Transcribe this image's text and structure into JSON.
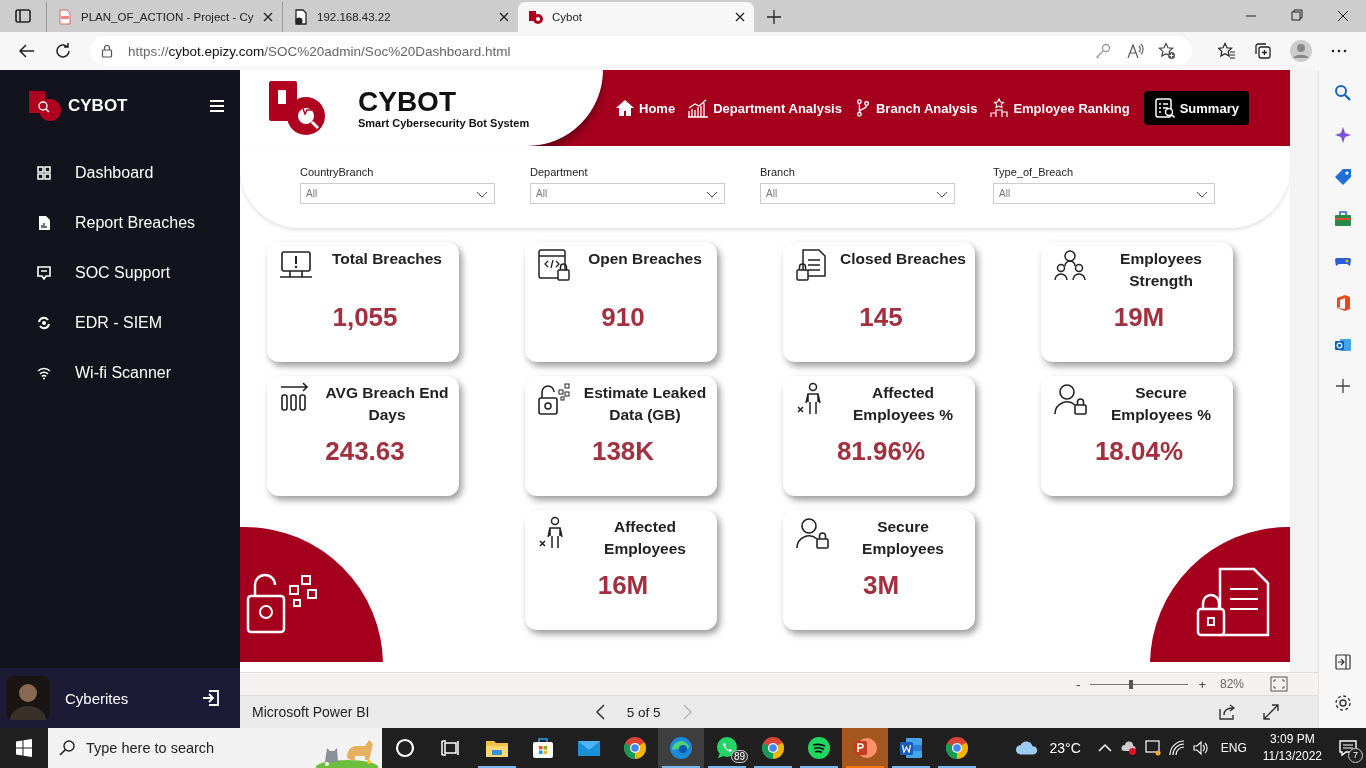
{
  "browser": {
    "tabs": [
      {
        "title": "PLAN_OF_ACTION - Project - Cy",
        "kind": "pdf",
        "selected": false
      },
      {
        "title": "192.168.43.22",
        "kind": "page",
        "selected": false
      },
      {
        "title": "Cybot",
        "kind": "cybot",
        "selected": true
      }
    ],
    "url_scheme": "https://",
    "url_host": "cybot.epizy.com",
    "url_path": "/SOC%20admin/Soc%20Dashboard.html"
  },
  "sidebar": {
    "brand": "CYBOT",
    "items": [
      {
        "label": "Dashboard"
      },
      {
        "label": "Report Breaches"
      },
      {
        "label": "SOC Support"
      },
      {
        "label": "EDR - SIEM"
      },
      {
        "label": "Wi-fi Scanner"
      }
    ],
    "user": "Cyberites"
  },
  "report": {
    "title": "CYBOT",
    "subtitle": "Smart Cybersecurity Bot System",
    "nav": [
      {
        "label": "Home",
        "selected": false
      },
      {
        "label": "Department Analysis",
        "selected": false
      },
      {
        "label": "Branch Analysis",
        "selected": false
      },
      {
        "label": "Employee Ranking",
        "selected": false
      },
      {
        "label": "Summary",
        "selected": true
      }
    ],
    "filters": [
      {
        "label": "CountryBranch",
        "value": "All"
      },
      {
        "label": "Department",
        "value": "All"
      },
      {
        "label": "Branch",
        "value": "All"
      },
      {
        "label": "Type_of_Breach",
        "value": "All"
      }
    ],
    "cards": [
      {
        "title": "Total Breaches",
        "value": "1,055"
      },
      {
        "title": "Open Breaches",
        "value": "910"
      },
      {
        "title": "Closed Breaches",
        "value": "145"
      },
      {
        "title": "Employees Strength",
        "value": "19M"
      },
      {
        "title": "AVG Breach End Days",
        "value": "243.63"
      },
      {
        "title": "Estimate Leaked Data (GB)",
        "value": "138K"
      },
      {
        "title": "Affected Employees %",
        "value": "81.96%"
      },
      {
        "title": "Secure Employees %",
        "value": "18.04%"
      },
      {
        "title": "Affected Employees",
        "value": "16M"
      },
      {
        "title": "Secure Employees",
        "value": "3M"
      }
    ]
  },
  "powerbi": {
    "zoom_out": "-",
    "zoom": {
      "level": 0.41
    },
    "zoom_in": "+",
    "zoom_reading": "82%",
    "app_name": "Microsoft Power BI",
    "page": "5 of 5"
  },
  "taskbar": {
    "search_placeholder": "Type here to search",
    "apps": [
      {
        "kind": "explorer",
        "running": true,
        "selected": false,
        "flashing": false
      },
      {
        "kind": "store",
        "running": false,
        "selected": false,
        "flashing": false
      },
      {
        "kind": "mail",
        "running": false,
        "selected": false,
        "flashing": false
      },
      {
        "kind": "chrome",
        "running": false,
        "selected": false,
        "flashing": false
      },
      {
        "kind": "edge",
        "running": true,
        "selected": true,
        "flashing": false
      },
      {
        "kind": "whatsapp",
        "running": true,
        "selected": false,
        "flashing": false,
        "badge": "89"
      },
      {
        "kind": "chrome",
        "running": true,
        "selected": false,
        "flashing": false
      },
      {
        "kind": "spotify",
        "running": true,
        "selected": false,
        "flashing": false
      },
      {
        "kind": "powerpoint",
        "running": true,
        "selected": false,
        "flashing": true
      },
      {
        "kind": "word",
        "running": true,
        "selected": false,
        "flashing": false
      },
      {
        "kind": "chrome",
        "running": true,
        "selected": false,
        "flashing": false
      }
    ],
    "weather": "23°C",
    "language": "ENG",
    "time": "3:09 PM",
    "date": "11/13/2022",
    "notifications": "7"
  }
}
